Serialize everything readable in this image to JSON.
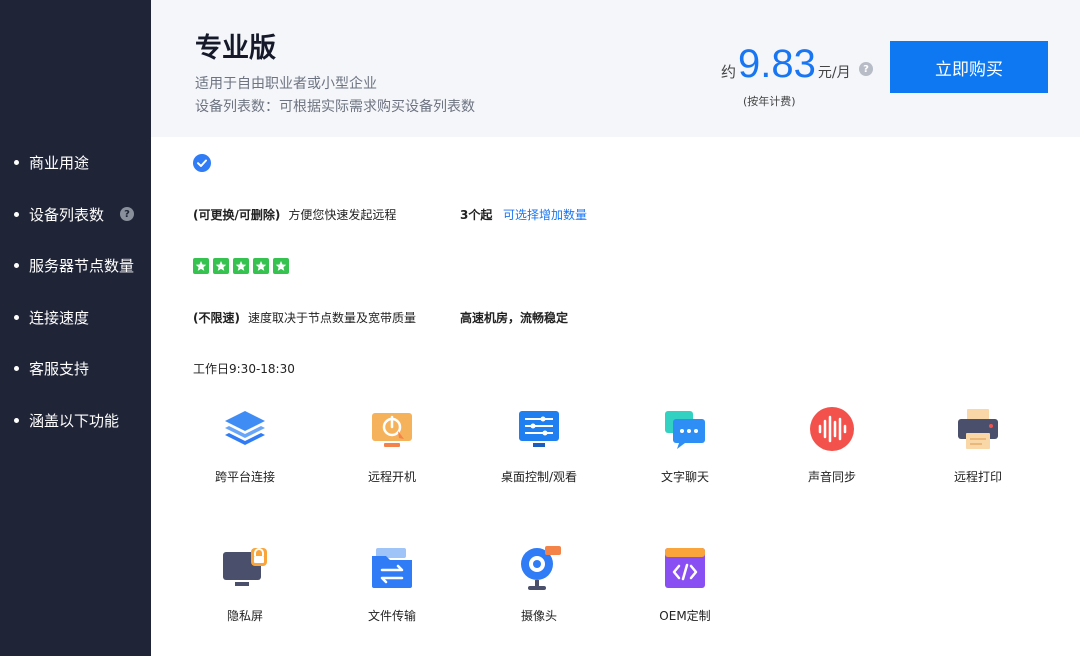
{
  "sidebar": {
    "items": [
      {
        "label": "商业用途"
      },
      {
        "label": "设备列表数"
      },
      {
        "label": "服务器节点数量"
      },
      {
        "label": "连接速度"
      },
      {
        "label": "客服支持"
      },
      {
        "label": "涵盖以下功能"
      }
    ]
  },
  "header": {
    "title": "专业版",
    "desc1": "适用于自由职业者或小型企业",
    "desc2": "设备列表数：可根据实际需求购买设备列表数",
    "price_prefix": "约",
    "price_value": "9.83",
    "price_unit": "元/月",
    "price_note": "(按年计费)",
    "buy_label": "立即购买"
  },
  "content": {
    "device_list": {
      "tag": "(可更换/可删除)",
      "text": "方便您快速发起远程",
      "count": "3个起",
      "link": "可选择增加数量"
    },
    "rating": {
      "stars": 5,
      "max": 5
    },
    "speed": {
      "tag": "(不限速)",
      "text": "速度取决于节点数量及宽带质量",
      "note": "高速机房，流畅稳定"
    },
    "support": {
      "text": "工作日9:30-18:30"
    }
  },
  "features": [
    {
      "label": "跨平台连接",
      "icon": "layers-icon"
    },
    {
      "label": "远程开机",
      "icon": "power-monitor-icon"
    },
    {
      "label": "桌面控制/观看",
      "icon": "desktop-control-icon"
    },
    {
      "label": "文字聊天",
      "icon": "chat-icon"
    },
    {
      "label": "声音同步",
      "icon": "sound-wave-icon"
    },
    {
      "label": "远程打印",
      "icon": "printer-icon"
    },
    {
      "label": "隐私屏",
      "icon": "privacy-screen-icon"
    },
    {
      "label": "文件传输",
      "icon": "file-transfer-icon"
    },
    {
      "label": "摄像头",
      "icon": "camera-icon"
    },
    {
      "label": "OEM定制",
      "icon": "code-window-icon"
    }
  ],
  "colors": {
    "sidebar_bg": "#1f2436",
    "header_bg": "#f4f6fa",
    "accent": "#0d78f2",
    "star": "#35c24f"
  }
}
